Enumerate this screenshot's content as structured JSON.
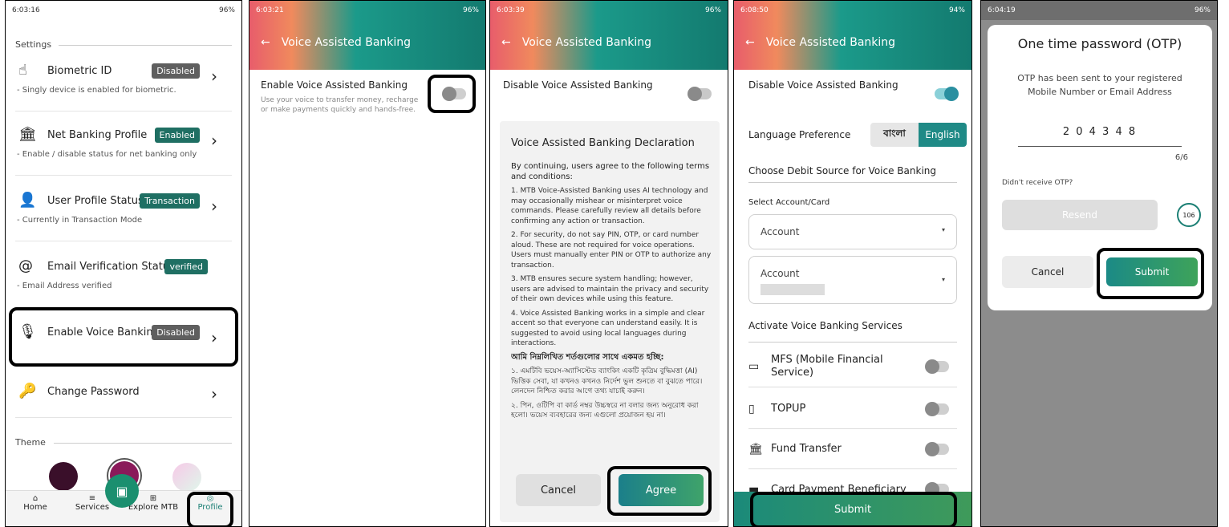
{
  "p1": {
    "status": {
      "time": "6:03:16",
      "battery": "96%"
    },
    "section": "Settings",
    "rows": [
      {
        "title": "Biometric ID",
        "sub": "- Singly device is enabled for biometric.",
        "badge": "Disabled"
      },
      {
        "title": "Net Banking Profile",
        "sub": "- Enable / disable status for net banking only",
        "badge": "Enabled"
      },
      {
        "title": "User Profile Status",
        "sub": "- Currently in Transaction Mode",
        "badge": "Transaction"
      },
      {
        "title": "Email Verification Status",
        "sub": "- Email Address verified",
        "badge": "verified"
      },
      {
        "title": "Enable Voice Banking",
        "sub": "",
        "badge": "Disabled"
      },
      {
        "title": "Change Password",
        "sub": "",
        "badge": ""
      }
    ],
    "theme": "Theme",
    "nav": [
      "Home",
      "Services",
      "Explore MTB",
      "Profile"
    ]
  },
  "p2": {
    "status": {
      "time": "6:03:21",
      "battery": "96%"
    },
    "title": "Voice Assisted Banking",
    "enable_label": "Enable Voice Assisted Banking",
    "enable_desc": "Use your voice to transfer money, recharge or make payments quickly and hands-free."
  },
  "p3": {
    "status": {
      "time": "6:03:39",
      "battery": "96%"
    },
    "title": "Voice Assisted Banking",
    "disable_label": "Disable Voice Assisted Banking",
    "decl_title": "Voice Assisted Banking Declaration",
    "intro": "By continuing, users agree to the following terms and conditions:",
    "terms": [
      "1. MTB Voice-Assisted Banking uses AI technology and may occasionally mishear or misinterpret voice commands. Please carefully review all details before confirming any action or transaction.",
      "2. For security, do not say PIN, OTP, or card number aloud. These are not required for voice operations. Users must manually enter PIN or OTP to authorize any transaction.",
      "3. MTB ensures secure system handling; however, users are advised to maintain the privacy and security of their own devices while using this feature.",
      "4. Voice Assisted Banking works in a simple and clear accent so that everyone can understand easily. It is suggested to avoid using local languages during interactions."
    ],
    "bn_title": "আমি নিম্নলিখিত শর্তগুলোর সাথে একমত হচ্ছি:",
    "bn_terms": [
      "১. এমটিবি ভয়েস-অ্যাসিস্টেড ব্যাংকিং একটি কৃত্রিম বুদ্ধিমত্তা (AI) ভিত্তিক সেবা, যা কখনও কখনও নির্দেশ ভুল শুনতে বা বুঝতে পারে। লেনদেন নিশ্চিত করার আগে তথ্য যাচাই করুন।",
      "২. পিন, ওটিপি বা কার্ড নম্বর উচ্চস্বরে না বলার জন্য অনুরোধ করা হলো। ভয়েস ব্যবহারের জন্য এগুলো প্রয়োজন হয় না।"
    ],
    "cancel": "Cancel",
    "agree": "Agree"
  },
  "p4": {
    "status": {
      "time": "6:08:50",
      "battery": "94%"
    },
    "title": "Voice Assisted Banking",
    "disable_label": "Disable Voice Assisted Banking",
    "lang_label": "Language Preference",
    "lang_options": [
      "বাংলা",
      "English"
    ],
    "debit_title": "Choose Debit Source for Voice Banking",
    "select_label": "Select Account/Card",
    "account1": "Account",
    "account2": "Account",
    "activate_title": "Activate Voice Banking Services",
    "services": [
      "MFS (Mobile Financial Service)",
      "TOPUP",
      "Fund Transfer",
      "Card Payment Beneficiary"
    ],
    "submit": "Submit"
  },
  "p5": {
    "status": {
      "time": "6:04:19",
      "battery": "96%"
    },
    "title": "One time password (OTP)",
    "msg": "OTP has been sent to your registered Mobile Number or Email Address",
    "otp": "2 0 4 3 4 8",
    "count": "6/6",
    "didnt": "Didn't receive OTP?",
    "resend": "Resend",
    "timer": "106",
    "cancel": "Cancel",
    "submit": "Submit"
  },
  "colors": {
    "teal": "#1b7f74",
    "badge_gray": "#5f5f5f",
    "badge_teal": "#1f6f63"
  }
}
